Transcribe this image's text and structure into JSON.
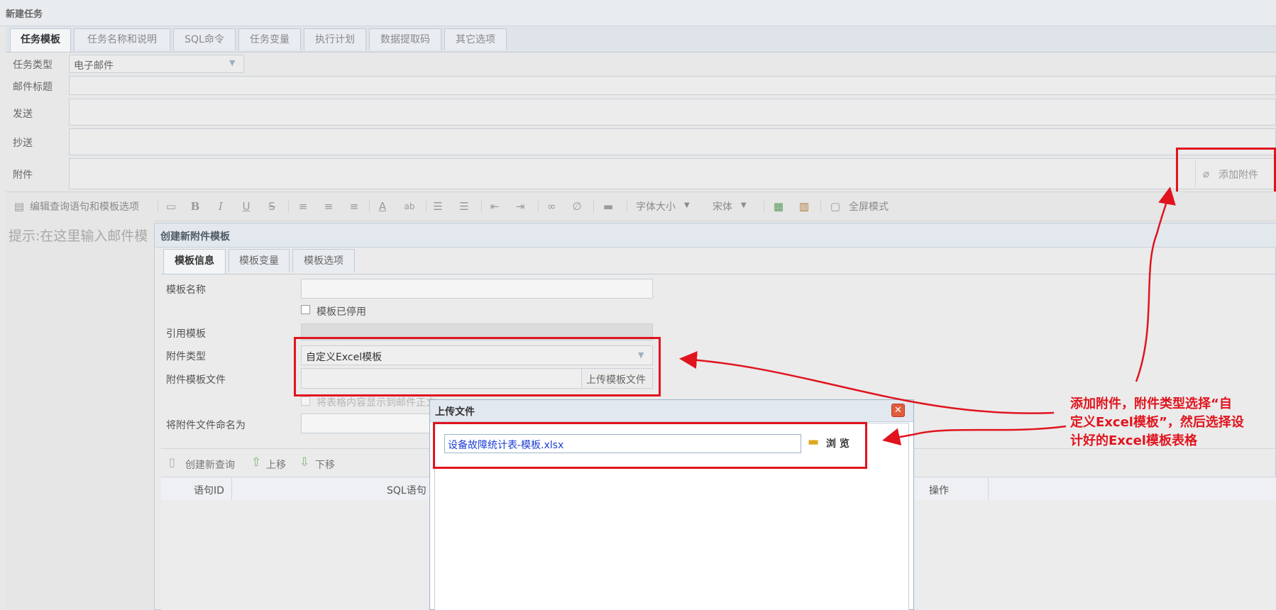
{
  "window": {
    "title": "新建任务"
  },
  "tabs": [
    {
      "label": "任务模板",
      "active": true
    },
    {
      "label": "任务名称和说明"
    },
    {
      "label": "SQL命令"
    },
    {
      "label": "任务变量"
    },
    {
      "label": "执行计划"
    },
    {
      "label": "数据提取码"
    },
    {
      "label": "其它选项"
    }
  ],
  "form": {
    "task_type_label": "任务类型",
    "task_type_value": "电子邮件",
    "subject_label": "邮件标题",
    "to_label": "发送",
    "cc_label": "抄送",
    "attachment_label": "附件",
    "add_attachment_button": "添加附件"
  },
  "toolbar": {
    "edit_query_label": "编辑查询语句和模板选项",
    "font_size_label": "字体大小",
    "font_family_label": "宋体",
    "fullscreen_label": "全屏模式"
  },
  "editor": {
    "hint": "提示:在这里输入邮件模"
  },
  "dialog": {
    "title": "创建新附件模板",
    "tabs": [
      {
        "label": "模板信息",
        "active": true
      },
      {
        "label": "模板变量"
      },
      {
        "label": "模板选项"
      }
    ],
    "template_name_label": "模板名称",
    "template_disabled_label": "模板已停用",
    "ref_template_label": "引用模板",
    "attach_type_label": "附件类型",
    "attach_type_value": "自定义Excel模板",
    "template_file_label": "附件模板文件",
    "upload_template_button": "上传模板文件",
    "show_in_body_label": "将表格内容显示到邮件正文",
    "rename_label": "将附件文件命名为",
    "query_toolbar": {
      "new_query": "创建新查询",
      "move_up": "上移",
      "move_down": "下移"
    },
    "grid_columns": [
      "语句ID",
      "SQL语句",
      "操作"
    ]
  },
  "upload_dialog": {
    "title": "上传文件",
    "file_value": "设备故障统计表-模板.xlsx",
    "browse_label": "浏 览"
  },
  "annotation": {
    "line1": "添加附件，附件类型选择“自",
    "line2": "定义Excel模板”，然后选择设",
    "line3": "计好的Excel模板表格"
  },
  "colors": {
    "annotation_red": "#e0141e",
    "link_blue": "#1d3fd6"
  }
}
